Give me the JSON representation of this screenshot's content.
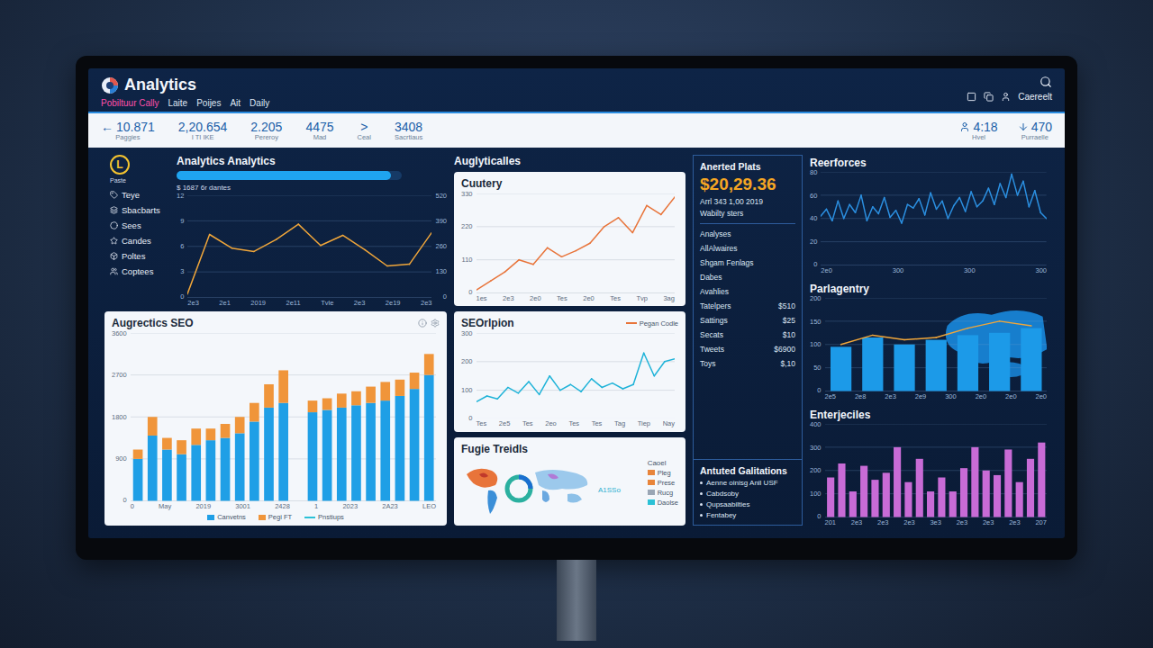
{
  "app": {
    "title": "Analytics",
    "nav": [
      {
        "label": "Pobiltuur Cally",
        "selected": true
      },
      {
        "label": "Laite",
        "selected": false
      },
      {
        "label": "Poijes",
        "selected": false
      },
      {
        "label": "Ait",
        "selected": false
      },
      {
        "label": "Daily",
        "selected": false
      }
    ],
    "user": "Caereelt"
  },
  "stats": [
    {
      "kind": "stat",
      "prefix": "←",
      "value": "10.871",
      "label": "Paggies"
    },
    {
      "kind": "stat",
      "value": "2,20.654",
      "label": "I TI IKE"
    },
    {
      "kind": "stat",
      "value": "2.205",
      "label": "Pereroy"
    },
    {
      "kind": "stat",
      "value": "4475",
      "label": "Mad"
    },
    {
      "kind": "chevron",
      "value": ">",
      "label": "Ceal"
    },
    {
      "kind": "stat",
      "value": "3408",
      "label": "Sacrtiaus"
    }
  ],
  "stats_right": [
    {
      "kind": "person",
      "value": "4:18",
      "label": "Hvel"
    },
    {
      "kind": "arrow",
      "value": "470",
      "label": "Purraelle"
    }
  ],
  "sidebar": {
    "badge": "L",
    "badge_label": "Paste",
    "items": [
      "Teye",
      "Sbacbarts",
      "Sees",
      "Candes",
      "Poltes",
      "Coptees"
    ]
  },
  "overview": {
    "title": "Analytics Analytics",
    "level": 0.95,
    "subtitle": "$ 1687 6r dantes",
    "chart": {
      "y_ticks": [
        "0",
        "3",
        "6",
        "9",
        "12"
      ],
      "y_ticks_right": [
        "0",
        "130",
        "260",
        "390",
        "520"
      ],
      "x_ticks": [
        "2e3",
        "2e1",
        "2019",
        "2e11",
        "Tvle",
        "2e3",
        "2e19",
        "2e3"
      ],
      "series": [
        {
          "kind": "line",
          "color": "#f0a63a",
          "values": [
            0.4,
            7.4,
            5.8,
            5.4,
            6.8,
            8.6,
            6.1,
            7.3,
            5.6,
            3.7,
            3.9,
            7.6
          ]
        }
      ]
    }
  },
  "section_title": "Auglyticalles",
  "country": {
    "title": "Cuutery",
    "chart": {
      "y_ticks": [
        "0",
        "110",
        "220",
        "330"
      ],
      "x_ticks": [
        "1es",
        "2e3",
        "2e0",
        "Tes",
        "2e0",
        "Tes",
        "Tvp",
        "3ag"
      ],
      "series": [
        {
          "kind": "line",
          "color": "#e8743a",
          "values": [
            10,
            40,
            70,
            110,
            95,
            150,
            120,
            140,
            165,
            220,
            250,
            200,
            290,
            260,
            320
          ]
        }
      ]
    }
  },
  "seo": {
    "title": "Augrectics SEO",
    "legend": [
      {
        "label": "Canvetns",
        "color": "#1f9fe6",
        "kind": "bar"
      },
      {
        "label": "Pegi FT",
        "color": "#f0953a",
        "kind": "bar"
      },
      {
        "label": "Pnstiups",
        "color": "#2bc1d6",
        "kind": "line"
      }
    ],
    "chart": {
      "y_ticks": [
        "0",
        "900",
        "1800",
        "2700",
        "3600"
      ],
      "x_ticks": [
        "0",
        "May",
        "2019",
        "3001",
        "2428",
        "1",
        "2023",
        "2A23",
        "LEO"
      ],
      "series": [
        {
          "kind": "bar",
          "color": "#1f9fe6",
          "values": [
            900,
            1400,
            1100,
            1000,
            1200,
            1300,
            1350,
            1450,
            1700,
            2000,
            2100,
            0,
            1900,
            1950,
            2000,
            2050,
            2100,
            2150,
            2250,
            2400,
            2700
          ]
        },
        {
          "kind": "bar",
          "color": "#f0953a",
          "values": [
            200,
            400,
            250,
            300,
            350,
            250,
            300,
            350,
            400,
            500,
            700,
            0,
            250,
            250,
            300,
            300,
            350,
            400,
            350,
            350,
            450
          ]
        }
      ]
    }
  },
  "seo_opinion": {
    "title": "SEOrlpion",
    "legend": [
      {
        "label": "Pegan Codle",
        "color": "#e8743a",
        "kind": "line"
      }
    ],
    "chart": {
      "y_ticks": [
        "0",
        "100",
        "200",
        "300"
      ],
      "x_ticks": [
        "Tes",
        "2e5",
        "Tes",
        "2eo",
        "Tes",
        "Tes",
        "Tag",
        "Tiep",
        "Nay"
      ],
      "series": [
        {
          "kind": "line",
          "color": "#1fb3d8",
          "values": [
            60,
            80,
            70,
            110,
            90,
            130,
            85,
            150,
            100,
            120,
            95,
            140,
            110,
            125,
            105,
            120,
            230,
            150,
            200,
            210
          ]
        }
      ]
    }
  },
  "trends": {
    "title": "Fugie Treidls",
    "legend_title": "Caoel",
    "legend": [
      {
        "label": "Pleg",
        "color": "#e8843a",
        "kind": "bar"
      },
      {
        "label": "Prese",
        "color": "#e8843a",
        "kind": "bar"
      },
      {
        "label": "Rucg",
        "color": "#9aa6b5",
        "kind": "bar"
      },
      {
        "label": "Daolse",
        "color": "#2bc1d6",
        "kind": "bar"
      }
    ],
    "note": "A1SSo"
  },
  "plans": {
    "title": "Anerted Plats",
    "amount": "$20,29.36",
    "date": "Arrl 343 1,00 2019",
    "caption": "Wabilty sters",
    "links": [
      "Analyses",
      "AllAlwaires",
      "Shgam Fenlags",
      "Dabes",
      "Avahlies"
    ],
    "rows": [
      {
        "label": "Tatelpers",
        "value": "$510"
      },
      {
        "label": "Sattings",
        "value": "$25"
      },
      {
        "label": "Secats",
        "value": "$10"
      },
      {
        "label": "Tweets",
        "value": "$6900"
      },
      {
        "label": "Toys",
        "value": "$,10"
      }
    ]
  },
  "galitations": {
    "title": "Antuted Galitations",
    "items": [
      "Aenne oinisg Anil USF",
      "Cabdsoby",
      "Qupsaabilties",
      "Fentabey"
    ]
  },
  "performance": {
    "title": "Reerforces",
    "chart": {
      "y_ticks": [
        "0",
        "20",
        "40",
        "60",
        "80"
      ],
      "x_ticks": [
        "2e0",
        "300",
        "300",
        "300"
      ],
      "series": [
        {
          "kind": "line",
          "color": "#2b8fe0",
          "values": [
            42,
            48,
            38,
            55,
            40,
            52,
            45,
            60,
            38,
            50,
            44,
            58,
            41,
            47,
            36,
            52,
            49,
            57,
            43,
            62,
            48,
            55,
            40,
            51,
            58,
            46,
            63,
            50,
            55,
            66,
            52,
            70,
            58,
            78,
            60,
            72,
            50,
            64,
            45,
            40
          ]
        }
      ]
    }
  },
  "parlagentry": {
    "title": "Parlagentry",
    "chart": {
      "y_ticks": [
        "0",
        "50",
        "100",
        "150",
        "200"
      ],
      "x_ticks": [
        "2e5",
        "2e8",
        "2e3",
        "2e9",
        "300",
        "2e0",
        "2e0",
        "2e0"
      ],
      "series": [
        {
          "kind": "bar",
          "color": "#1c9ae8",
          "values": [
            95,
            115,
            100,
            110,
            120,
            125,
            135
          ]
        },
        {
          "kind": "line",
          "color": "#f0a63a",
          "values": [
            100,
            120,
            110,
            115,
            135,
            150,
            140
          ]
        }
      ]
    }
  },
  "enterjeciles": {
    "title": "Enterjeciles",
    "chart": {
      "y_ticks": [
        "0",
        "100",
        "200",
        "300",
        "400"
      ],
      "x_ticks": [
        "201",
        "2e3",
        "2e3",
        "2e3",
        "3e3",
        "2e3",
        "2e3",
        "2e3",
        "207"
      ],
      "series": [
        {
          "kind": "bar",
          "color": "#c86bd6",
          "values": [
            170,
            230,
            110,
            220,
            160,
            190,
            300,
            150,
            250,
            110,
            170,
            110,
            210,
            300,
            200,
            180,
            290,
            150,
            250,
            320
          ]
        }
      ]
    }
  }
}
